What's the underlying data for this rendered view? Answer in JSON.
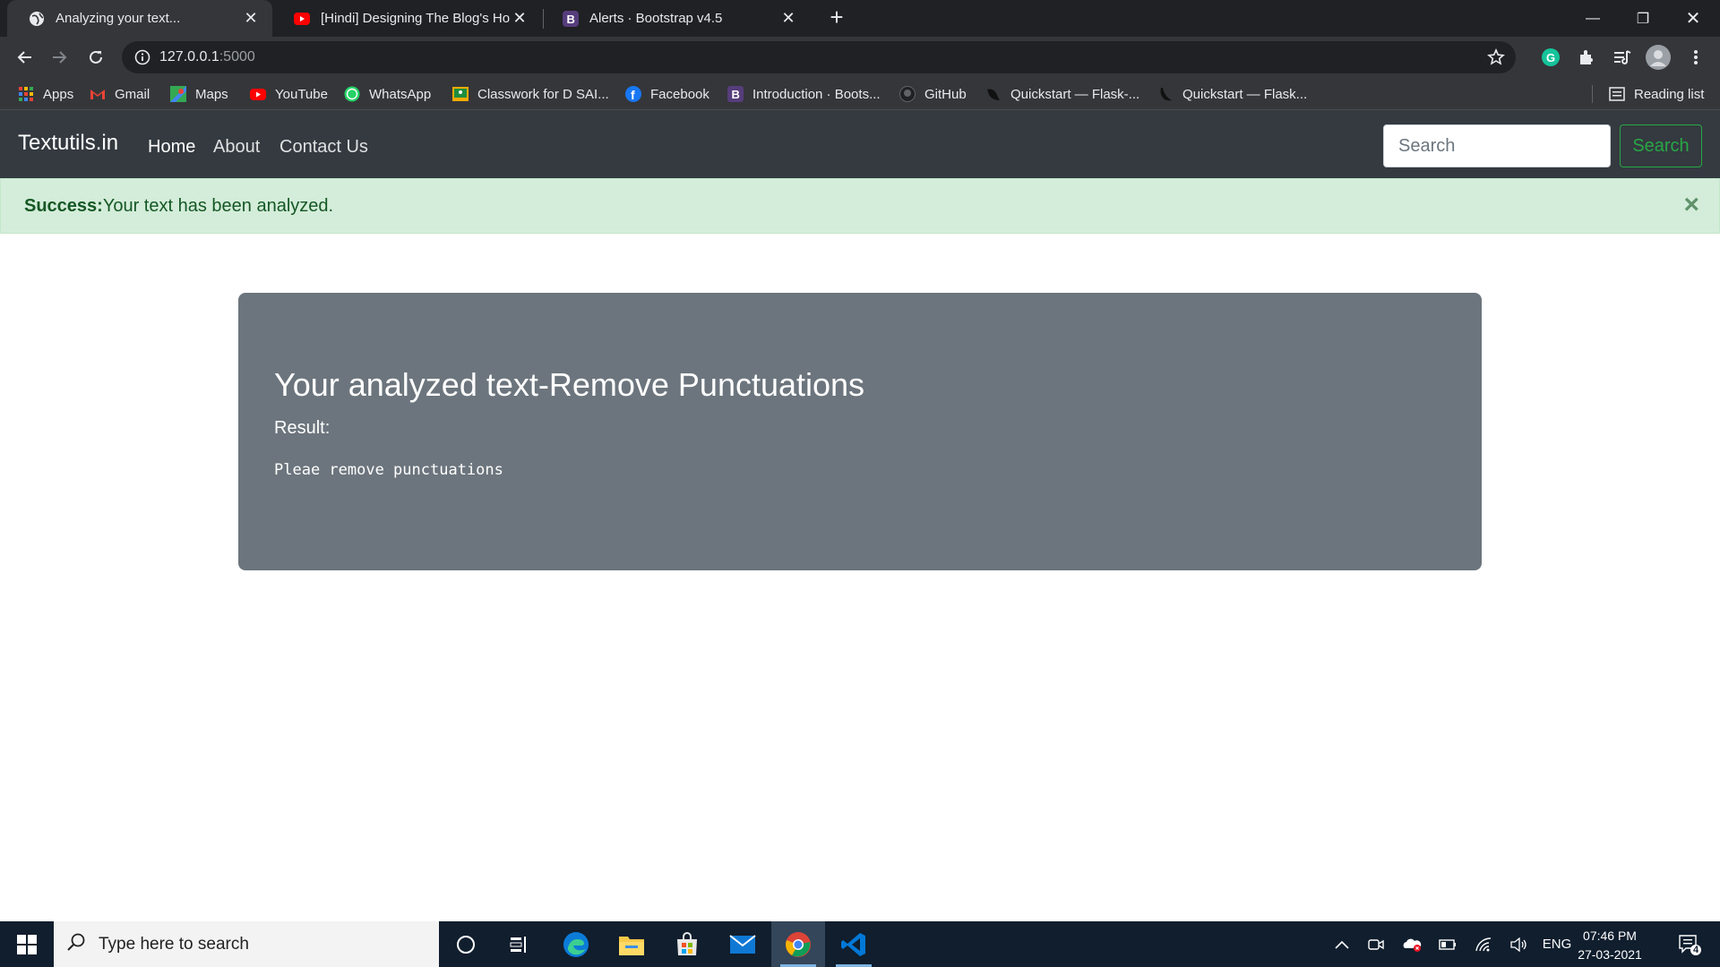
{
  "browser": {
    "tabs": [
      {
        "title": "Analyzing your text...",
        "favicon": "globe-icon",
        "active": true
      },
      {
        "title": "[Hindi] Designing The Blog's Hom",
        "favicon": "youtube-icon",
        "active": false
      },
      {
        "title": "Alerts · Bootstrap v4.5",
        "favicon": "bootstrap-icon",
        "active": false
      }
    ],
    "url_host": "127.0.0.1",
    "url_port": ":5000",
    "bookmarks": [
      {
        "label": "Apps",
        "icon": "apps-grid-icon"
      },
      {
        "label": "Gmail",
        "icon": "gmail-icon"
      },
      {
        "label": "Maps",
        "icon": "maps-icon"
      },
      {
        "label": "YouTube",
        "icon": "youtube-icon"
      },
      {
        "label": "WhatsApp",
        "icon": "whatsapp-icon"
      },
      {
        "label": "Classwork for D SAI...",
        "icon": "classroom-icon"
      },
      {
        "label": "Facebook",
        "icon": "facebook-icon"
      },
      {
        "label": "Introduction · Boots...",
        "icon": "bootstrap-icon"
      },
      {
        "label": "GitHub",
        "icon": "github-icon"
      },
      {
        "label": "Quickstart — Flask-...",
        "icon": "flask-icon"
      },
      {
        "label": "Quickstart — Flask...",
        "icon": "flask-icon"
      }
    ],
    "reading_list": "Reading list"
  },
  "site": {
    "brand": "Textutils.in",
    "nav": [
      "Home",
      "About",
      "Contact Us"
    ],
    "search_placeholder": "Search",
    "search_button": "Search"
  },
  "alert": {
    "strong": "Success:",
    "message": "Your text has been analyzed.",
    "close": "×"
  },
  "result": {
    "heading": "Your analyzed text-Remove Punctuations",
    "label": "Result:",
    "text": "Pleae remove punctuations"
  },
  "taskbar": {
    "search_placeholder": "Type here to search",
    "language": "ENG",
    "time": "07:46 PM",
    "date": "27-03-2021",
    "notifications": "4"
  },
  "colors": {
    "navbar": "#343a40",
    "alert_bg": "#d4edda",
    "alert_text": "#155724",
    "jumbotron": "#6c757d",
    "search_btn": "#28a745"
  }
}
